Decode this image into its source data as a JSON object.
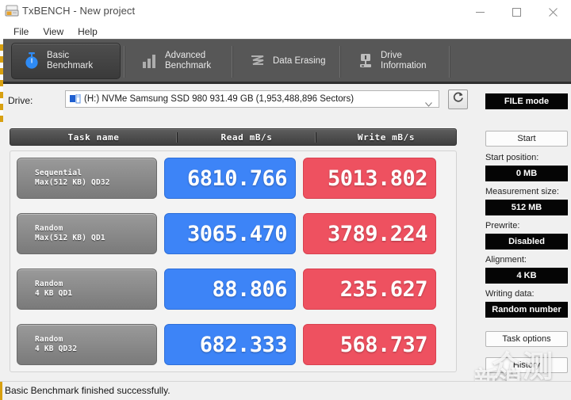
{
  "window": {
    "title": "TxBENCH - New project",
    "icon": "drive-icon",
    "minimize": "—",
    "maximize": "□",
    "close": "✕"
  },
  "menu": {
    "items": [
      {
        "label": "File"
      },
      {
        "label": "View"
      },
      {
        "label": "Help"
      }
    ]
  },
  "tabs": [
    {
      "label_line1": "Basic",
      "label_line2": "Benchmark",
      "icon": "stopwatch-icon",
      "active": true
    },
    {
      "label_line1": "Advanced",
      "label_line2": "Benchmark",
      "icon": "bar-chart-icon",
      "active": false
    },
    {
      "label_line1": "Data Erasing",
      "label_line2": "",
      "icon": "erase-icon",
      "active": false
    },
    {
      "label_line1": "Drive",
      "label_line2": "Information",
      "icon": "drive-info-icon",
      "active": false
    }
  ],
  "drive": {
    "label": "Drive:",
    "value": "(H:) NVMe Samsung SSD 980  931.49 GB (1,953,488,896 Sectors)",
    "icon": "hard-disk-icon",
    "caret": "chevron-down-icon",
    "refresh_icon": "refresh-icon"
  },
  "table": {
    "headers": [
      "Task name",
      "Read mB/s",
      "Write mB/s"
    ],
    "rows": [
      {
        "task_line1": "Sequential",
        "task_line2": "Max(512 KB) QD32",
        "read": "6810.766",
        "write": "5013.802"
      },
      {
        "task_line1": "Random",
        "task_line2": "Max(512 KB) QD1",
        "read": "3065.470",
        "write": "3789.224"
      },
      {
        "task_line1": "Random",
        "task_line2": "4 KB QD1",
        "read": "88.806",
        "write": "235.627"
      },
      {
        "task_line1": "Random",
        "task_line2": "4 KB QD32",
        "read": "682.333",
        "write": "568.737"
      }
    ]
  },
  "sidebar": {
    "mode_button": "FILE mode",
    "start_button": "Start",
    "start_position_label": "Start position:",
    "start_position_value": "0 MB",
    "measurement_size_label": "Measurement size:",
    "measurement_size_value": "512 MB",
    "prewrite_label": "Prewrite:",
    "prewrite_value": "Disabled",
    "alignment_label": "Alignment:",
    "alignment_value": "4 KB",
    "writing_data_label": "Writing data:",
    "writing_data_value": "Random number",
    "task_options_button": "Task options",
    "history_button": "History"
  },
  "status": {
    "text": "Basic Benchmark finished successfully."
  },
  "watermark": {
    "line1": "众测",
    "line2": "新浪"
  },
  "colors": {
    "read_blue": "#3d84f7",
    "write_red": "#ee5160",
    "tab_bar": "#575757",
    "accent_rail": "#d8a010"
  }
}
